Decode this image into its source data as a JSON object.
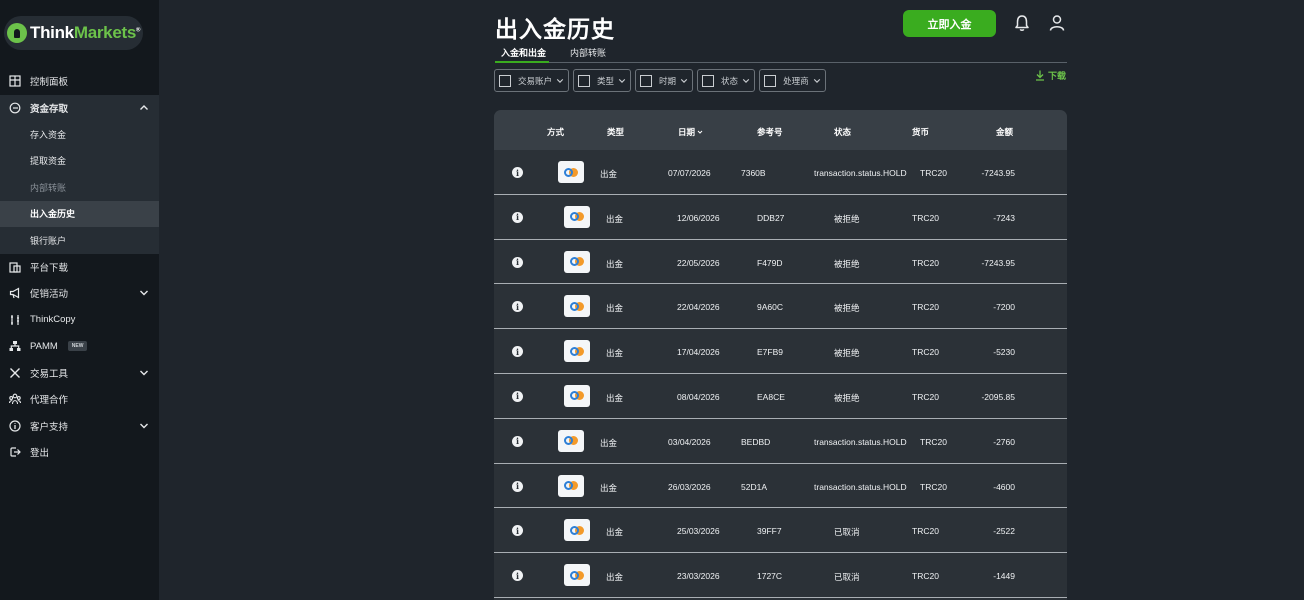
{
  "brand": {
    "think": "Think",
    "markets": "Markets",
    "reg": "®"
  },
  "sidebar": {
    "items": [
      {
        "id": "dashboard",
        "label": "控制面板",
        "icon": "dashboard-icon"
      },
      {
        "id": "funds",
        "label": "资金存取",
        "icon": "wallet-icon",
        "open": true,
        "children": [
          {
            "label": "存入资金"
          },
          {
            "label": "提取资金"
          },
          {
            "label": "内部转账",
            "dim": true
          },
          {
            "label": "出入金历史",
            "active": true
          },
          {
            "label": "银行账户"
          }
        ]
      },
      {
        "id": "platform",
        "label": "平台下载",
        "icon": "download-platform-icon"
      },
      {
        "id": "promo",
        "label": "促销活动",
        "icon": "megaphone-icon",
        "chevron": true
      },
      {
        "id": "thinkcopy",
        "label": "ThinkCopy",
        "icon": "copy-trade-icon"
      },
      {
        "id": "pamm",
        "label": "PAMM",
        "icon": "network-icon",
        "badge": "NEW"
      },
      {
        "id": "tools",
        "label": "交易工具",
        "icon": "tools-icon",
        "chevron": true
      },
      {
        "id": "partner",
        "label": "代理合作",
        "icon": "partners-icon"
      },
      {
        "id": "support",
        "label": "客户支持",
        "icon": "info-circle-icon",
        "chevron": true
      },
      {
        "id": "logout",
        "label": "登出",
        "icon": "logout-icon"
      }
    ]
  },
  "header": {
    "title": "出入金历史",
    "deposit_button": "立即入金"
  },
  "tabs": [
    {
      "label": "入金和出金",
      "active": true
    },
    {
      "label": "内部转账"
    }
  ],
  "filters": [
    {
      "label": "交易账户"
    },
    {
      "label": "类型"
    },
    {
      "label": "时期"
    },
    {
      "label": "状态"
    },
    {
      "label": "处理商"
    }
  ],
  "download_label": "下载",
  "table": {
    "columns": [
      "方式",
      "类型",
      "日期",
      "参考号",
      "状态",
      "货币",
      "金额"
    ],
    "rows": [
      {
        "type": "出金",
        "date": "07/07/2026",
        "ref": "7360B",
        "status": "transaction.status.HOLD",
        "currency": "TRC20",
        "amount": "-7243.95",
        "hold": true
      },
      {
        "type": "出金",
        "date": "12/06/2026",
        "ref": "DDB27",
        "status": "被拒绝",
        "currency": "TRC20",
        "amount": "-7243",
        "hold": false
      },
      {
        "type": "出金",
        "date": "22/05/2026",
        "ref": "F479D",
        "status": "被拒绝",
        "currency": "TRC20",
        "amount": "-7243.95",
        "hold": false
      },
      {
        "type": "出金",
        "date": "22/04/2026",
        "ref": "9A60C",
        "status": "被拒绝",
        "currency": "TRC20",
        "amount": "-7200",
        "hold": false
      },
      {
        "type": "出金",
        "date": "17/04/2026",
        "ref": "E7FB9",
        "status": "被拒绝",
        "currency": "TRC20",
        "amount": "-5230",
        "hold": false
      },
      {
        "type": "出金",
        "date": "08/04/2026",
        "ref": "EA8CE",
        "status": "被拒绝",
        "currency": "TRC20",
        "amount": "-2095.85",
        "hold": false
      },
      {
        "type": "出金",
        "date": "03/04/2026",
        "ref": "BEDBD",
        "status": "transaction.status.HOLD",
        "currency": "TRC20",
        "amount": "-2760",
        "hold": true
      },
      {
        "type": "出金",
        "date": "26/03/2026",
        "ref": "52D1A",
        "status": "transaction.status.HOLD",
        "currency": "TRC20",
        "amount": "-4600",
        "hold": true
      },
      {
        "type": "出金",
        "date": "25/03/2026",
        "ref": "39FF7",
        "status": "已取消",
        "currency": "TRC20",
        "amount": "-2522",
        "hold": false
      },
      {
        "type": "出金",
        "date": "23/03/2026",
        "ref": "1727C",
        "status": "已取消",
        "currency": "TRC20",
        "amount": "-1449",
        "hold": false
      }
    ]
  },
  "colors": {
    "accent": "#3aac1f",
    "brand_green": "#6cc24a",
    "sidebar_bg": "#13181d",
    "page_bg": "#1f252c"
  }
}
